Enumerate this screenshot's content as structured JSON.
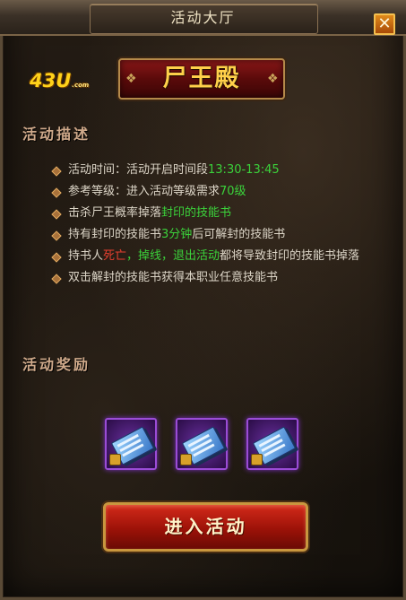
{
  "window": {
    "title": "活动大厅",
    "close_icon": "✕"
  },
  "logo": {
    "text": "43U",
    "sub": ".com"
  },
  "banner": {
    "title": "尸王殿"
  },
  "description": {
    "heading": "活动描述",
    "items": [
      {
        "a": "活动时间：活动开启时间段",
        "b": "13:30-13:45",
        "c": ""
      },
      {
        "a": "参考等级：进入活动等级需求",
        "b": "70级",
        "c": ""
      },
      {
        "a": "击杀尸王概率掉落",
        "b": "封印的技能书",
        "c": ""
      },
      {
        "a": "持有封印的技能书",
        "b": "3分钟",
        "c": "后可解封的技能书"
      },
      {
        "a": "持书人",
        "r1": "死亡",
        "g1": "，掉线，退出活动",
        "c": "都将导致封印的技能书掉落"
      },
      {
        "a": "双击解封的技能书获得本职业任意技能书",
        "b": "",
        "c": ""
      }
    ]
  },
  "rewards": {
    "heading": "活动奖励",
    "items": [
      {
        "icon": "skill-book-icon",
        "locked": true
      },
      {
        "icon": "skill-book-icon",
        "locked": true
      },
      {
        "icon": "skill-book-icon",
        "locked": true
      }
    ]
  },
  "actions": {
    "enter_label": "进入活动"
  },
  "colors": {
    "accent_green": "#3bd23b",
    "accent_red": "#e84030",
    "gold": "#ffd04a"
  }
}
